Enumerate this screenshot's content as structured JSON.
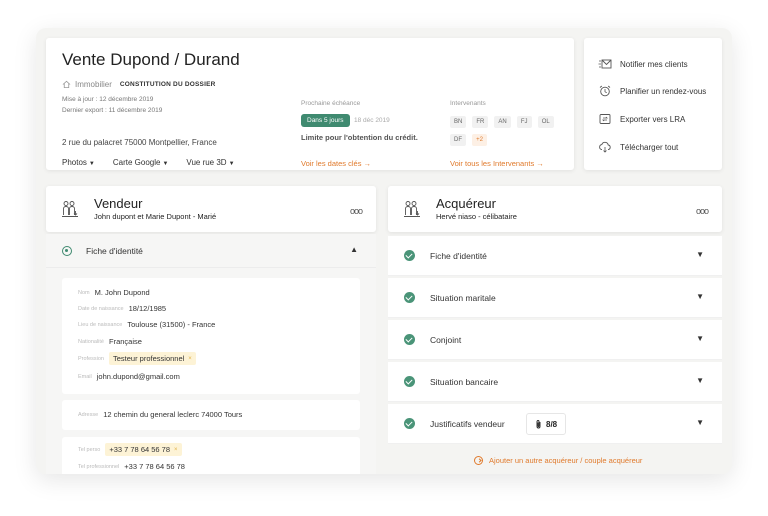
{
  "header": {
    "title": "Vente Dupond / Durand",
    "category": "Immobilier",
    "stage": "CONSTITUTION DU DOSSIER",
    "updated": "Mise à jour : 12 décembre 2019",
    "exported": "Dernier export : 11 décembre 2019",
    "address": "2 rue du palacret 75000 Montpellier, France",
    "links": [
      "Photos",
      "Carte Google",
      "Vue rue 3D"
    ],
    "next_deadline_label": "Prochaine échéance",
    "deadline_pill": "Dans 5 jours",
    "deadline_date": "18 déc 2019",
    "deadline_text": "Limite pour l'obtention du crédit.",
    "deadline_link": "Voir les dates clés →",
    "participants_label": "Intervenants",
    "participants": [
      "BN",
      "FR",
      "AN",
      "FJ",
      "OL",
      "DF"
    ],
    "participants_more": "+2",
    "participants_link": "Voir tous les Intervenants →"
  },
  "actions": [
    {
      "label": "Notifier mes clients",
      "icon": "notify-icon"
    },
    {
      "label": "Planifier un rendez-vous",
      "icon": "alarm-clock-icon"
    },
    {
      "label": "Exporter vers LRA",
      "icon": "export-icon"
    },
    {
      "label": "Télécharger tout",
      "icon": "cloud-download-icon"
    }
  ],
  "vendeur": {
    "title": "Vendeur",
    "subtitle": "John dupont et Marie Dupont - Marié",
    "more": "ooo",
    "section": "Fiche d'identité",
    "fields": [
      {
        "label": "Nom",
        "value": "M. John Dupond"
      },
      {
        "label": "Date de naissance",
        "value": "18/12/1985"
      },
      {
        "label": "Lieu de naissance",
        "value": "Toulouse (31500) - France"
      },
      {
        "label": "Nationalité",
        "value": "Française"
      },
      {
        "label": "Profession",
        "value": "Testeur professionnel"
      },
      {
        "label": "Email",
        "value": "john.dupond@gmail.com"
      }
    ],
    "address_label": "Adresse",
    "address_value": "12 chemin du general leclerc 74000 Tours",
    "phones": [
      {
        "label": "Tel perso",
        "value": "+33 7 78 64 56 78"
      },
      {
        "label": "Tel professionnel",
        "value": "+33 7 78 64 56 78"
      }
    ],
    "remove_glyph": "×"
  },
  "acquereur": {
    "title": "Acquéreur",
    "subtitle": "Hervé niaso - célibataire",
    "more": "ooo",
    "items": [
      "Fiche d'identité",
      "Situation maritale",
      "Conjoint",
      "Situation bancaire",
      "Justificatifs vendeur"
    ],
    "docs_count": "8/8",
    "add_link": "Ajouter un autre acquéreur / couple acquéreur"
  },
  "colors": {
    "accent": "#3f8a70",
    "link": "#e07a2c",
    "highlight": "#fdf3d6"
  }
}
